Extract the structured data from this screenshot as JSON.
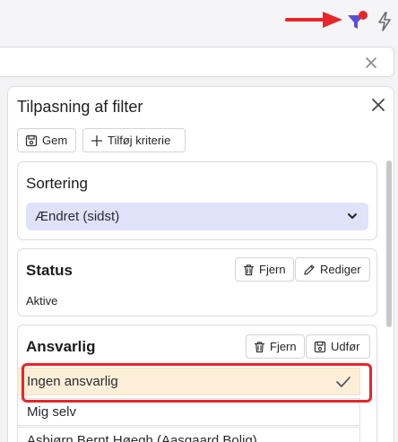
{
  "panel": {
    "title": "Tilpasning af filter",
    "save_label": "Gem",
    "add_criterion_label": "Tilføj kriterie"
  },
  "search": {
    "value": "",
    "placeholder": ""
  },
  "sorting": {
    "title": "Sortering",
    "selected": "Ændret (sidst)"
  },
  "status": {
    "title": "Status",
    "remove_label": "Fjern",
    "edit_label": "Rediger",
    "value": "Aktive"
  },
  "responsible": {
    "title": "Ansvarlig",
    "remove_label": "Fjern",
    "export_label": "Udfør",
    "options": [
      {
        "label": "Ingen ansvarlig",
        "selected": true
      },
      {
        "label": "Mig selv",
        "selected": false
      },
      {
        "label": "Asbjørn Bernt Høegh (Aasgaard Bolig)",
        "selected": false
      }
    ]
  },
  "colors": {
    "accent": "#5b4fd6",
    "annotation_red": "#e8262a",
    "selected_bg": "#fdeed8",
    "select_bg": "#e0e2fa"
  },
  "icons": {
    "filter": "filter-icon",
    "notification_dot": "notification-dot",
    "bolt": "bolt-icon",
    "close": "close-icon",
    "save": "floppy-disk-icon",
    "add": "plus-icon",
    "trash": "trash-icon",
    "pencil": "pencil-icon",
    "chevron": "chevron-down-icon",
    "check": "checkmark-icon"
  }
}
